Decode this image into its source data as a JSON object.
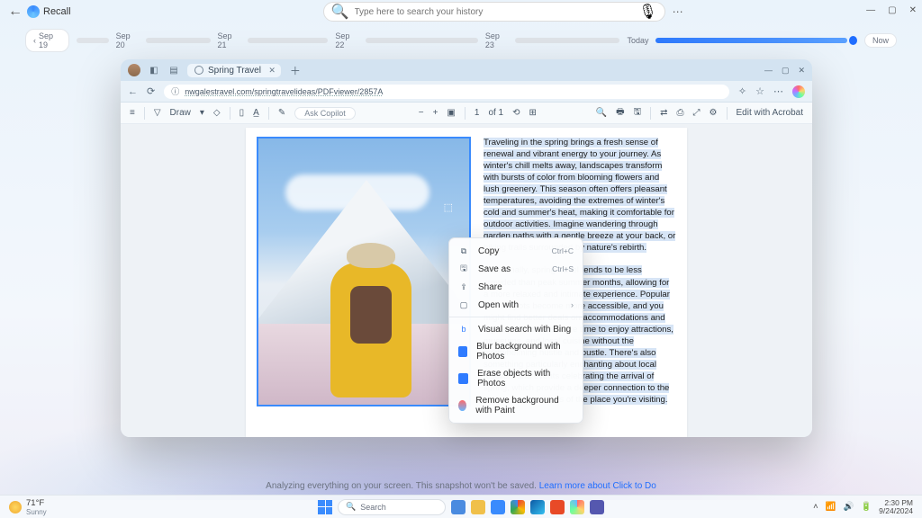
{
  "app": {
    "title": "Recall"
  },
  "search": {
    "placeholder": "Type here to search your history"
  },
  "timeline": {
    "start_label": "Sep 19",
    "days": [
      "Sep 20",
      "Sep 21",
      "Sep 22",
      "Sep 23"
    ],
    "today": "Today",
    "now": "Now"
  },
  "browser": {
    "tab": "Spring Travel",
    "url": "nwgalestravel.com/springtravelideas/PDFviewer/2857A"
  },
  "pdf": {
    "draw": "Draw",
    "ask": "Ask Copilot",
    "page_cur": "1",
    "page_of": "of 1",
    "edit": "Edit with Acrobat",
    "para1": "Traveling in the spring brings a fresh sense of renewal and vibrant energy to your journey. As winter's chill melts away, landscapes transform with bursts of color from blooming flowers and lush greenery. This season often offers pleasant temperatures, avoiding the extremes of winter's cold and summer's heat, making it comfortable for outdoor activities. Imagine wandering through garden paths with a gentle breeze at your back, or hiking trails surrounded by nature's rebirth.",
    "para2": "Additionally, spring travel tends to be less crowded than peak summer months, allowing for a more relaxed and intimate experience. Popular tourist spots become more accessible, and you might find better deals on accommodations and flights. This means more time to enjoy attractions, museums, and local cuisine without the overwhelming hustle and bustle. There's also something particularly enchanting about local festivals and events celebrating the arrival of spring, which provide a deeper connection to the culture and traditions of the place you're visiting."
  },
  "ctx": {
    "copy": "Copy",
    "copy_sc": "Ctrl+C",
    "saveas": "Save as",
    "saveas_sc": "Ctrl+S",
    "share": "Share",
    "openwith": "Open with",
    "visual": "Visual search with Bing",
    "blur": "Blur background with Photos",
    "erase": "Erase objects with Photos",
    "removebg": "Remove background with Paint"
  },
  "footer": {
    "msg": "Analyzing everything on your screen. This snapshot won't be saved.  ",
    "link": "Learn more about Click to Do"
  },
  "taskbar": {
    "temp": "71°F",
    "cond": "Sunny",
    "search": "Search",
    "time": "2:30 PM",
    "date": "9/24/2024"
  }
}
